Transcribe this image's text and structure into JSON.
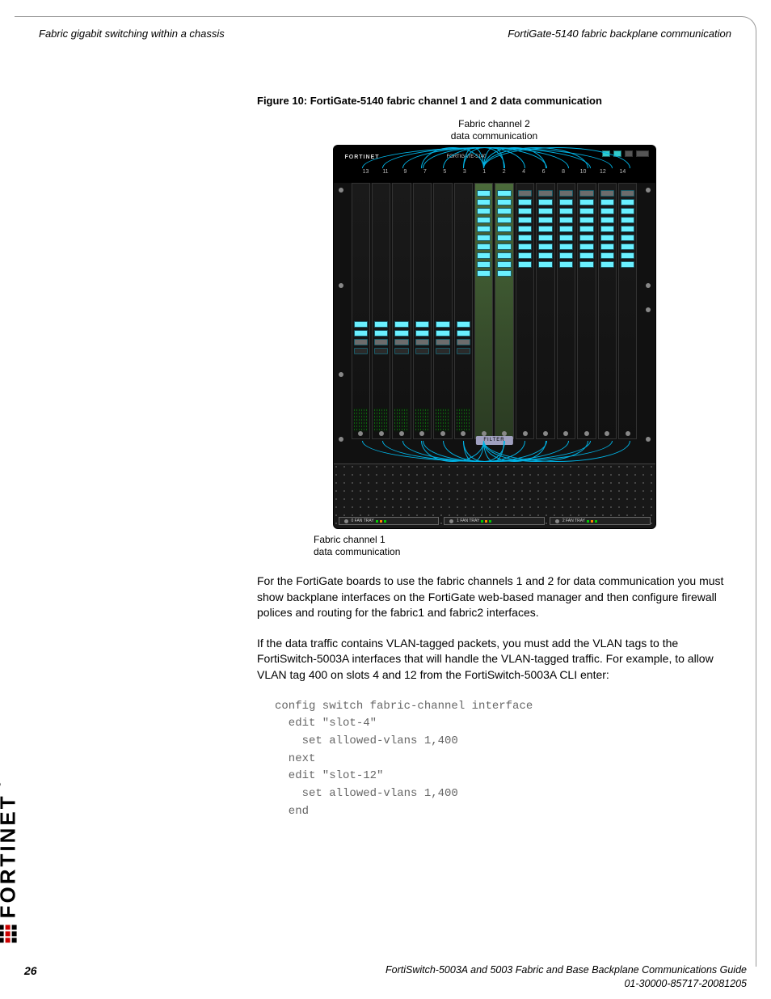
{
  "header": {
    "left": "Fabric gigabit switching within a chassis",
    "right": "FortiGate-5140 fabric backplane communication"
  },
  "figure": {
    "caption": "Figure 10: FortiGate-5140 fabric channel 1 and 2 data communication",
    "label_top_line1": "Fabric channel 2",
    "label_top_line2": "data communication",
    "label_bot_line1": "Fabric channel 1",
    "label_bot_line2": "data communication",
    "brand": "FORTINET",
    "model": "FORTIGATE-5140",
    "filter": "FILTER",
    "slots": [
      "13",
      "11",
      "9",
      "7",
      "5",
      "3",
      "1",
      "2",
      "4",
      "6",
      "8",
      "10",
      "12",
      "14"
    ],
    "fan_tray_labels": [
      "0 FAN TRAY",
      "1 FAN TRAY",
      "2 FAN TRAY"
    ]
  },
  "body": {
    "p1": "For the FortiGate boards to use the fabric channels 1 and 2 for data communication you must show backplane interfaces on the FortiGate web-based manager and then configure firewall polices and routing for the fabric1 and fabric2 interfaces.",
    "p2": "If the data traffic contains VLAN-tagged packets, you must add the VLAN tags to the FortiSwitch-5003A interfaces that will handle the VLAN-tagged traffic. For example, to allow VLAN tag 400 on slots 4 and 12 from the FortiSwitch-5003A CLI enter:"
  },
  "code": "config switch fabric-channel interface\n  edit \"slot-4\"\n    set allowed-vlans 1,400\n  next\n  edit \"slot-12\"\n    set allowed-vlans 1,400\n  end",
  "side_brand": "FORTINET",
  "footer": {
    "line1": "FortiSwitch-5003A and 5003   Fabric and Base Backplane Communications Guide",
    "line2": "01-30000-85717-20081205",
    "page": "26"
  }
}
